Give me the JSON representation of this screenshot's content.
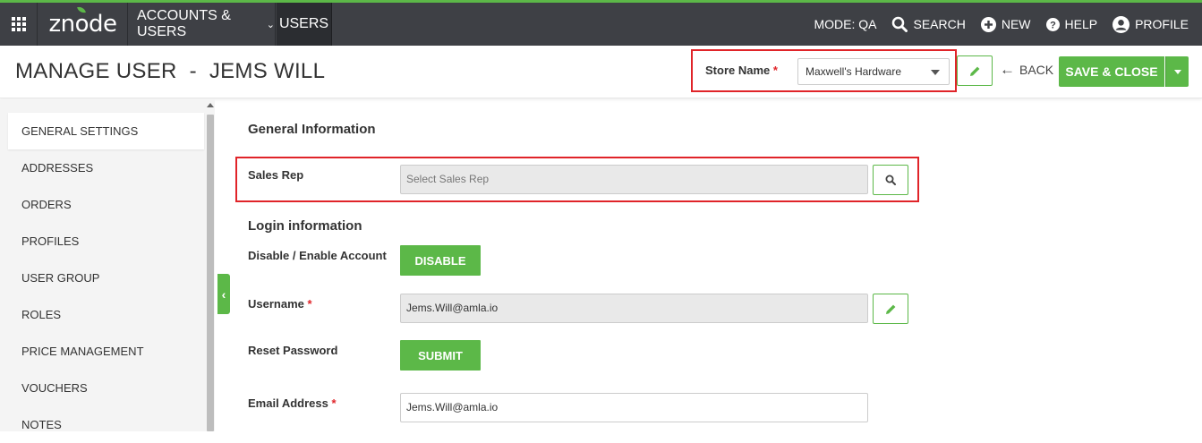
{
  "nav": {
    "logo": "znode",
    "accounts_menu": "ACCOUNTS & USERS",
    "users_menu": "USERS",
    "mode": "MODE: QA",
    "search": "SEARCH",
    "new": "NEW",
    "help": "HELP",
    "profile": "PROFILE",
    "accent_color": "#5cb848",
    "bar_color": "#3e4045"
  },
  "header": {
    "title": "MANAGE USER  -  JEMS WILL",
    "store_label": "Store Name",
    "store_required": "*",
    "store_value": "Maxwell's Hardware",
    "back": "BACK",
    "save_close": "SAVE & CLOSE"
  },
  "sidebar": {
    "items": [
      {
        "label": "GENERAL SETTINGS"
      },
      {
        "label": "ADDRESSES"
      },
      {
        "label": "ORDERS"
      },
      {
        "label": "PROFILES"
      },
      {
        "label": "USER GROUP"
      },
      {
        "label": "ROLES"
      },
      {
        "label": "PRICE MANAGEMENT"
      },
      {
        "label": "VOUCHERS"
      },
      {
        "label": "NOTES"
      }
    ],
    "active_index": 0
  },
  "form": {
    "general_title": "General Information",
    "sales_rep_label": "Sales Rep",
    "sales_rep_placeholder": "Select Sales Rep",
    "login_title": "Login information",
    "disable_label": "Disable / Enable Account",
    "disable_button": "DISABLE",
    "username_label": "Username",
    "username_value": "Jems.Will@amla.io",
    "reset_label": "Reset Password",
    "submit_button": "SUBMIT",
    "email_label": "Email Address",
    "email_value": "Jems.Will@amla.io",
    "required_mark": "*"
  },
  "highlight_color": "#e02429"
}
